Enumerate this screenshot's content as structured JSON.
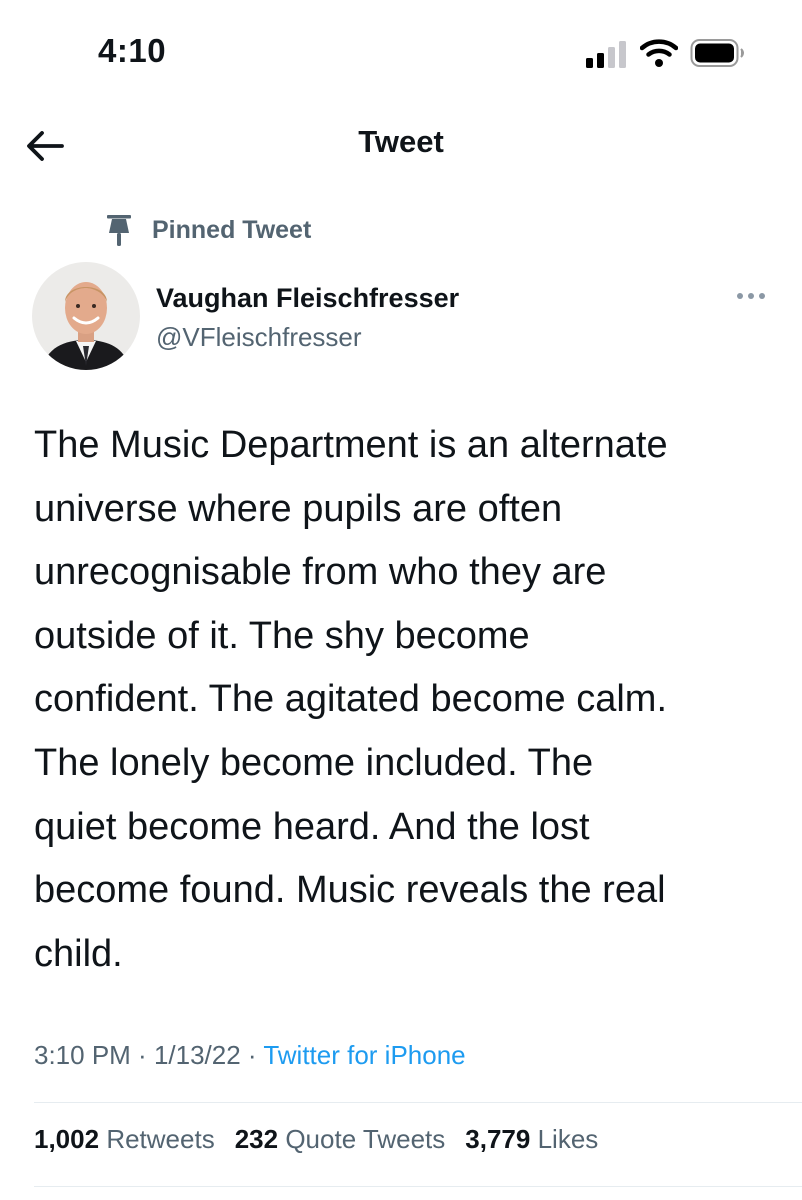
{
  "status_bar": {
    "time": "4:10"
  },
  "header": {
    "title": "Tweet"
  },
  "tweet": {
    "pinned_label": "Pinned Tweet",
    "author_name": "Vaughan Fleischfresser",
    "author_handle": "@VFleischfresser",
    "text": "The Music Department is an alternate\nuniverse where pupils are often\nunrecognisable from who they are\noutside of it. The shy become\nconfident. The agitated become calm.\nThe lonely become included. The\nquiet become heard. And the lost\nbecome found. Music reveals the real\nchild.",
    "time": "3:10 PM",
    "date": "1/13/22",
    "separator": " · ",
    "source": "Twitter for iPhone"
  },
  "stats": {
    "retweets_count": "1,002",
    "retweets_label": "Retweets",
    "quotes_count": "232",
    "quotes_label": "Quote Tweets",
    "likes_count": "3,779",
    "likes_label": "Likes"
  },
  "icons": {
    "signal": "cellular-signal-icon",
    "wifi": "wifi-icon",
    "battery": "battery-icon",
    "back": "back-arrow-icon",
    "pin": "pin-icon",
    "more": "more-icon"
  },
  "colors": {
    "text_primary": "#0f1419",
    "text_secondary": "#536471",
    "link": "#1d9bf0",
    "divider": "#e6ecf0"
  }
}
